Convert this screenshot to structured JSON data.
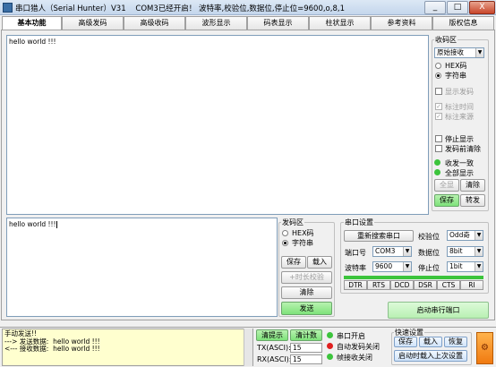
{
  "window": {
    "title": "串口猎人（Serial Hunter）V31",
    "status": "COM3已经开启！ 波特率,校验位,数据位,停止位=9600,o,8,1",
    "min_label": "_",
    "max_label": "□",
    "close_label": "X"
  },
  "tabs": [
    "基本功能",
    "高级发码",
    "高级收码",
    "波形显示",
    "码表显示",
    "柱状显示",
    "参考资料",
    "版权信息"
  ],
  "receive_area": {
    "text": "hello world !!!"
  },
  "receive_panel": {
    "group_label": "收码区",
    "mode_value": "原始接收",
    "hex_label": "HEX码",
    "string_label": "字符串",
    "show_send_label": "显示发码",
    "mark_time_label": "标注时间",
    "mark_source_label": "标注来源",
    "stop_display_label": "停止显示",
    "clear_before_send_label": "发码前清除",
    "rx_one_label": "收发一致",
    "show_all_label": "全部显示",
    "select_all_label": "全显",
    "clear_label": "清除",
    "save_label": "保存",
    "transfer_label": "转发"
  },
  "send_area": {
    "text": "hello world !!!"
  },
  "send_panel": {
    "group_label": "发码区",
    "hex_label": "HEX码",
    "string_label": "字符串",
    "save_label": "保存",
    "load_label": "载入",
    "checksum_label": "+时长校验",
    "clear_label": "清除",
    "send_label": "发送"
  },
  "serial_settings": {
    "group_label": "串口设置",
    "rescan_label": "重新搜索串口",
    "parity_label": "校验位",
    "parity_value": "Odd奇",
    "port_label": "端口号",
    "port_value": "COM3",
    "databits_label": "数据位",
    "databits_value": "8bit",
    "baud_label": "波特率",
    "baud_value": "9600",
    "stopbits_label": "停止位",
    "stopbits_value": "1bit",
    "signals": [
      "DTR",
      "RTS",
      "DCD",
      "DSR",
      "CTS",
      "RI"
    ],
    "open_port_label": "启动串行端口"
  },
  "status": {
    "log_lines": [
      "手动发送!!",
      "---> 发送数据:  hello world !!!",
      "<--- 接收数据:  hello world !!!"
    ],
    "clear_tip_label": "清提示",
    "clear_count_label": "清计数",
    "tx_label": "TX(ASCI):",
    "tx_value": "15",
    "rx_label": "RX(ASCI):",
    "rx_value": "15",
    "port_open_label": "串口开启",
    "auto_send_off_label": "自动发码关闭",
    "frame_rx_off_label": "帧接收关闭",
    "quick_settings_label": "快速设置",
    "qs_save_label": "保存",
    "qs_load_label": "载入",
    "qs_restore_label": "恢复",
    "qs_autoload_label": "启动时载入上次设置"
  },
  "colors": {
    "green_led": "#3cc43c",
    "red_led": "#e02020",
    "log_bg": "#ffffcf",
    "send_button": "#7ee27a",
    "titlebar": "#c4d6ec"
  }
}
